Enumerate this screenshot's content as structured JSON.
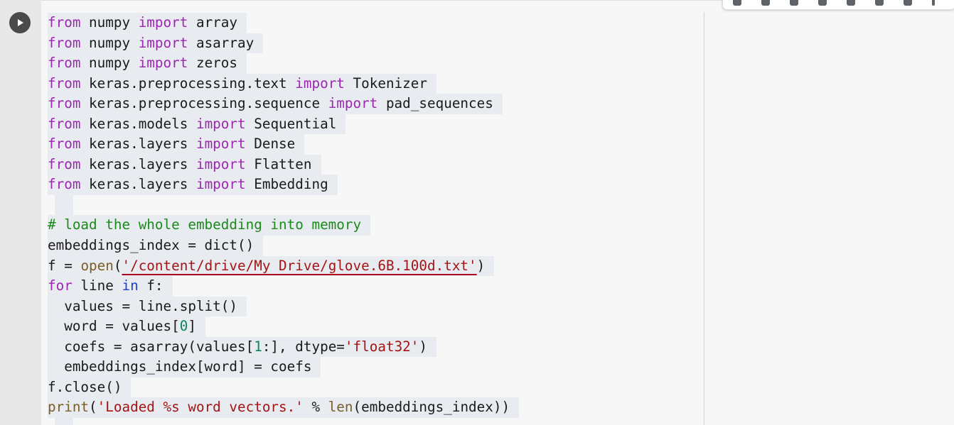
{
  "cell": {
    "run_icon": "play-icon",
    "toolbar_icons": [
      "arrow-up-icon",
      "arrow-down-icon",
      "link-icon",
      "comment-icon",
      "gear-icon",
      "edit-icon",
      "delete-icon",
      "more-vert-icon"
    ]
  },
  "code": {
    "lines": [
      [
        {
          "t": "from",
          "c": "kw"
        },
        {
          "t": " numpy ",
          "c": ""
        },
        {
          "t": "import",
          "c": "kw"
        },
        {
          "t": " array",
          "c": ""
        }
      ],
      [
        {
          "t": "from",
          "c": "kw"
        },
        {
          "t": " numpy ",
          "c": ""
        },
        {
          "t": "import",
          "c": "kw"
        },
        {
          "t": " asarray",
          "c": ""
        }
      ],
      [
        {
          "t": "from",
          "c": "kw"
        },
        {
          "t": " numpy ",
          "c": ""
        },
        {
          "t": "import",
          "c": "kw"
        },
        {
          "t": " zeros",
          "c": ""
        }
      ],
      [
        {
          "t": "from",
          "c": "kw"
        },
        {
          "t": " keras.preprocessing.text ",
          "c": ""
        },
        {
          "t": "import",
          "c": "kw"
        },
        {
          "t": " Tokenizer",
          "c": ""
        }
      ],
      [
        {
          "t": "from",
          "c": "kw"
        },
        {
          "t": " keras.preprocessing.sequence ",
          "c": ""
        },
        {
          "t": "import",
          "c": "kw"
        },
        {
          "t": " pad_sequences",
          "c": ""
        }
      ],
      [
        {
          "t": "from",
          "c": "kw"
        },
        {
          "t": " keras.models ",
          "c": ""
        },
        {
          "t": "import",
          "c": "kw"
        },
        {
          "t": " Sequential",
          "c": ""
        }
      ],
      [
        {
          "t": "from",
          "c": "kw"
        },
        {
          "t": " keras.layers ",
          "c": ""
        },
        {
          "t": "import",
          "c": "kw"
        },
        {
          "t": " Dense",
          "c": ""
        }
      ],
      [
        {
          "t": "from",
          "c": "kw"
        },
        {
          "t": " keras.layers ",
          "c": ""
        },
        {
          "t": "import",
          "c": "kw"
        },
        {
          "t": " Flatten",
          "c": ""
        }
      ],
      [
        {
          "t": "from",
          "c": "kw"
        },
        {
          "t": " keras.layers ",
          "c": ""
        },
        {
          "t": "import",
          "c": "kw"
        },
        {
          "t": " Embedding",
          "c": ""
        }
      ],
      [],
      [
        {
          "t": "# load the whole embedding into memory",
          "c": "cmt"
        }
      ],
      [
        {
          "t": "embeddings_index = dict()",
          "c": ""
        }
      ],
      [
        {
          "t": "f = ",
          "c": ""
        },
        {
          "t": "open",
          "c": "fn"
        },
        {
          "t": "(",
          "c": ""
        },
        {
          "t": "'/content/drive/My Drive/glove.6B.100d.txt'",
          "c": "str squig"
        },
        {
          "t": ")",
          "c": ""
        }
      ],
      [
        {
          "t": "for",
          "c": "kw"
        },
        {
          "t": " line ",
          "c": ""
        },
        {
          "t": "in",
          "c": "kw2"
        },
        {
          "t": " f:",
          "c": ""
        }
      ],
      [
        {
          "t": "  values = line.split()",
          "c": ""
        }
      ],
      [
        {
          "t": "  word = values[",
          "c": ""
        },
        {
          "t": "0",
          "c": "num"
        },
        {
          "t": "]",
          "c": ""
        }
      ],
      [
        {
          "t": "  coefs = asarray(values[",
          "c": ""
        },
        {
          "t": "1",
          "c": "num"
        },
        {
          "t": ":], dtype=",
          "c": ""
        },
        {
          "t": "'float32'",
          "c": "str"
        },
        {
          "t": ")",
          "c": ""
        }
      ],
      [
        {
          "t": "  embeddings_index[word] = coefs",
          "c": ""
        }
      ],
      [
        {
          "t": "f.close()",
          "c": ""
        }
      ],
      [
        {
          "t": "print",
          "c": "fn"
        },
        {
          "t": "(",
          "c": ""
        },
        {
          "t": "'Loaded %s word vectors.'",
          "c": "str"
        },
        {
          "t": " % ",
          "c": ""
        },
        {
          "t": "len",
          "c": "fn"
        },
        {
          "t": "(embeddings_index))",
          "c": ""
        }
      ],
      []
    ]
  }
}
